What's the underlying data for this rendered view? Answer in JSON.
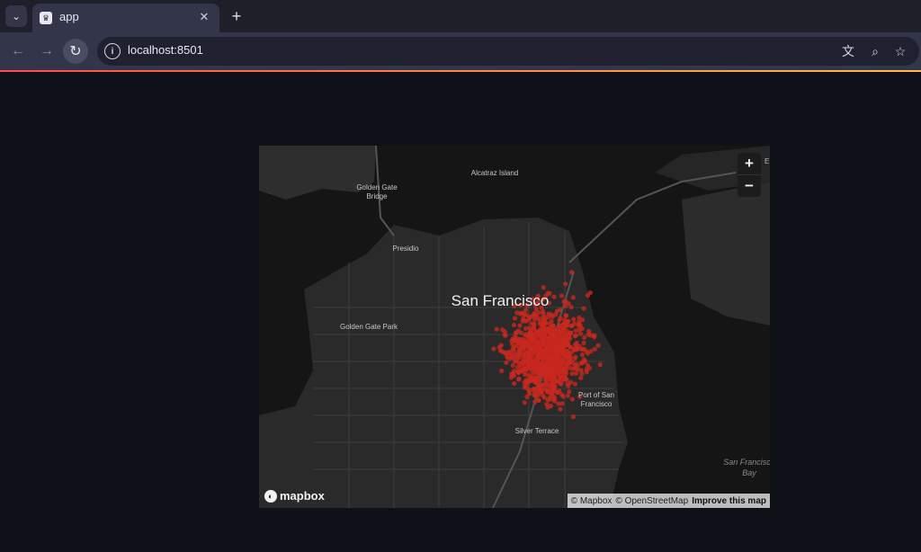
{
  "browser": {
    "tab": {
      "title": "app",
      "favicon_icon": "streamlit-crown-icon"
    },
    "tab_list_icon": "chevron-down-icon",
    "new_tab_icon": "plus-icon",
    "close_icon": "close-icon",
    "url": "localhost:8501",
    "toolbar_icons": [
      "back-icon",
      "forward-icon",
      "reload-icon",
      "info-icon",
      "translate-icon",
      "zoom-icon",
      "star-icon"
    ]
  },
  "theme": {
    "page_bg": "#0e1117",
    "accent_start": "#ff4b4b",
    "accent_end": "#ffbd45",
    "point_color": "#c8281e"
  },
  "map": {
    "city_label": "San Francisco",
    "place_labels": [
      {
        "text": "Alcatraz Island",
        "size": "small"
      },
      {
        "text": "Golden Gate",
        "size": "small"
      },
      {
        "text": "Bridge",
        "size": "small"
      },
      {
        "text": "Presidio",
        "size": "small"
      },
      {
        "text": "Golden Gate Park",
        "size": "small"
      },
      {
        "text": "Port of San",
        "size": "small"
      },
      {
        "text": "Francisco",
        "size": "small"
      },
      {
        "text": "Silver Terrace",
        "size": "small"
      },
      {
        "text": "San Francisco",
        "size": "italic"
      },
      {
        "text": "Bay",
        "size": "italic"
      },
      {
        "text": "E",
        "size": "small"
      }
    ],
    "zoom_in_label": "+",
    "zoom_out_label": "−",
    "logo_text": "mapbox",
    "attribution": {
      "mapbox": "© Mapbox",
      "osm": "© OpenStreetMap",
      "improve": "Improve this map"
    }
  }
}
